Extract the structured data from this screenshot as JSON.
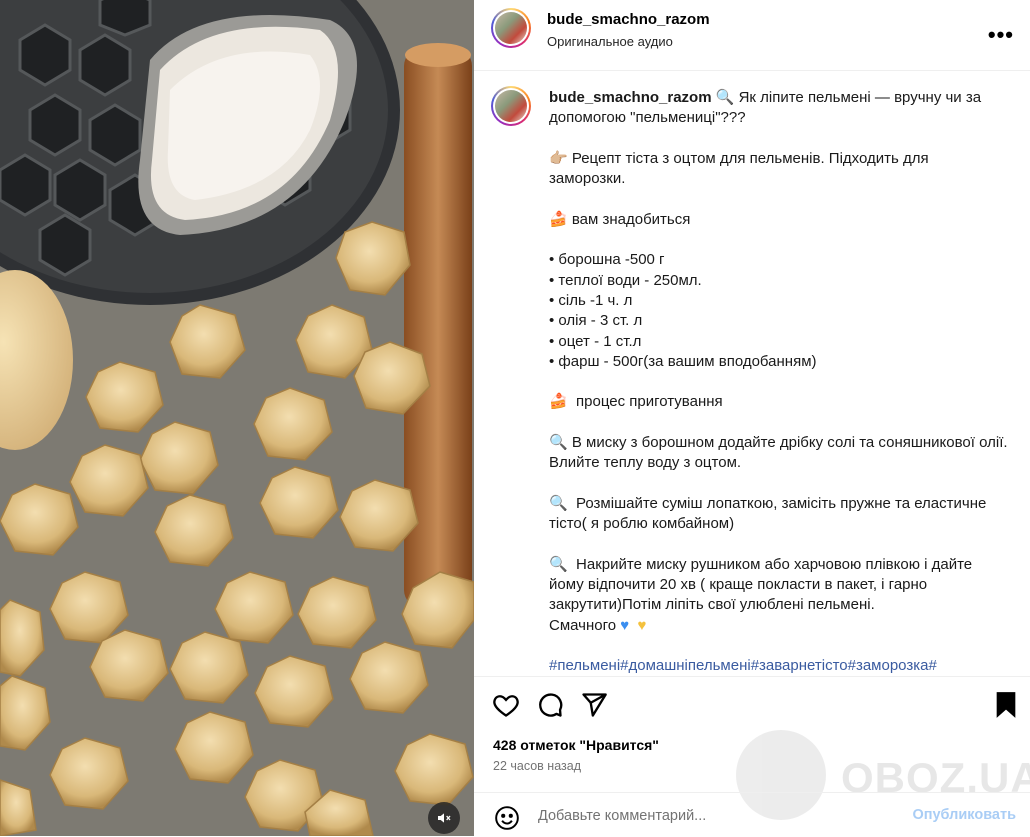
{
  "post": {
    "username": "bude_smachno_razom",
    "audio_label": "Оригинальное аудио",
    "more_label": "•••"
  },
  "caption": {
    "username": "bude_smachno_razom",
    "intro": "Як ліпите пельмені — вручну чи за допомогою \"пельмениці\"???",
    "recipe_intro": "Рецепт тіста з оцтом для пельменів. Підходить для заморозки.",
    "need_heading": "вам знадобиться",
    "ingredients": [
      "• борошна -500 г",
      "• теплої води - 250мл.",
      "• сіль -1 ч. л",
      "• олія - 3 ст. л",
      "• оцет - 1 ст.л",
      "• фарш - 500г(за вашим вподобанням)"
    ],
    "process_heading": "процес приготування",
    "step1": "В миску з борошном додайте дрібку солі та соняшникової олії. Влийте теплу воду з оцтом.",
    "step2": "Розмішайте суміш лопаткою, замісіть пружне та еластичне тісто( я роблю комбайном)",
    "step3": "Накрийте миску рушником або харчовою плівкою і дайте йому відпочити 20 хв ( краще покласти в пакет, і гарно закрутити)Потім ліпіть свої улюблені пельмені.",
    "closing": "Смачного",
    "hashtags": "#пельмені#домашніпельмені#заварнетісто#заморозка#"
  },
  "engagement": {
    "likes": "428 отметок \"Нравится\"",
    "time": "22 часов назад"
  },
  "comment": {
    "placeholder": "Добавьте комментарий...",
    "post_label": "Опубликовать"
  },
  "watermark": {
    "text": "OBOZ.UA"
  },
  "icons": {
    "more": "more-options-icon",
    "like": "heart-icon",
    "comment": "comment-icon",
    "share": "share-icon",
    "save": "bookmark-icon",
    "emoji": "emoji-icon",
    "mute": "speaker-muted-icon",
    "search_emoji": "magnifier-emoji",
    "finger_emoji": "pointing-finger-emoji",
    "cake_emoji": "cake-emoji",
    "hearts": [
      "blue-heart-emoji",
      "yellow-heart-emoji"
    ]
  },
  "colors": {
    "hashtag": "#3a5ba0",
    "post_button": "#a9cdf5",
    "blue_heart": "#3a8ef0",
    "yellow_heart": "#f4c13d"
  }
}
